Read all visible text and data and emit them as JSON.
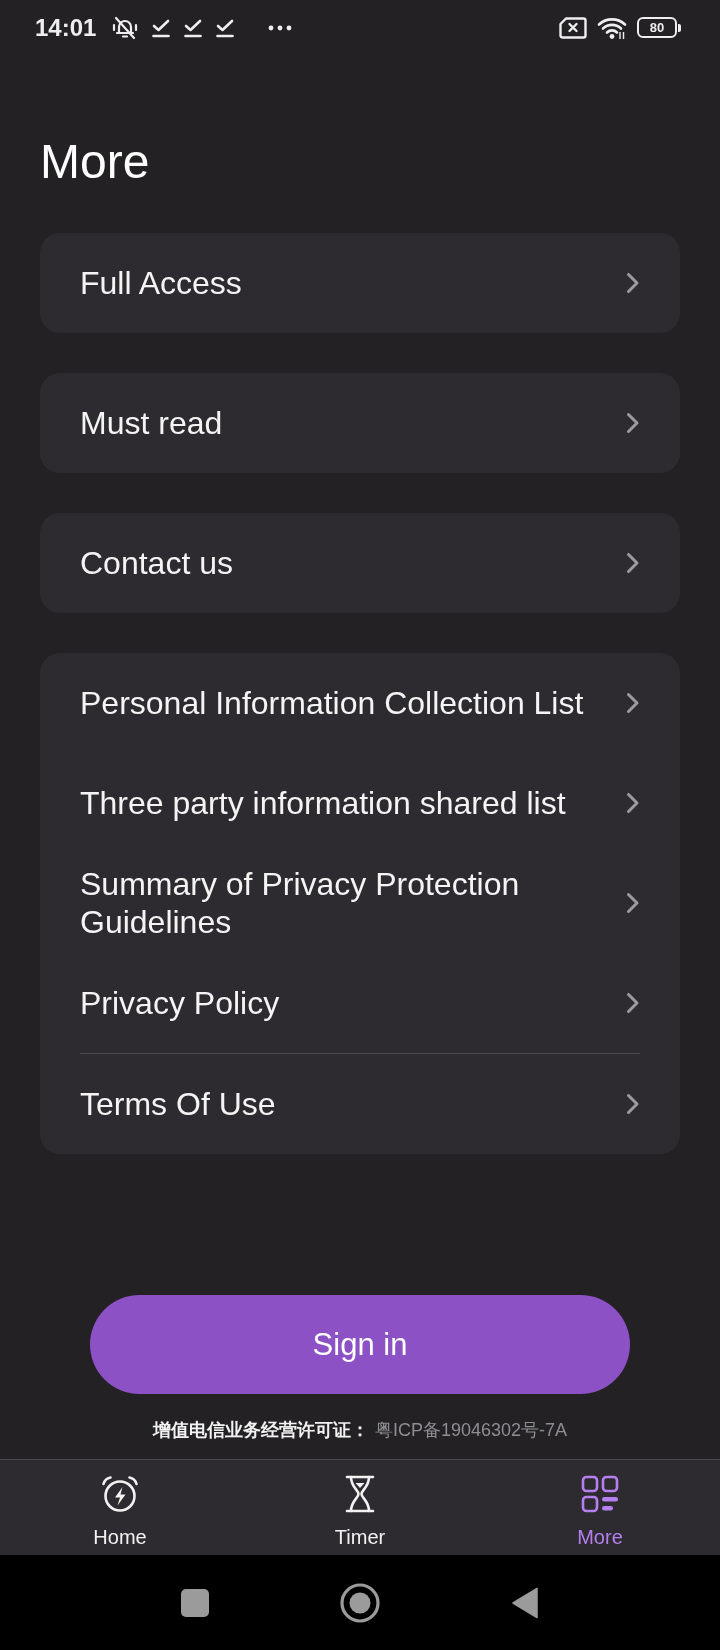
{
  "status_bar": {
    "time": "14:01",
    "battery": "80"
  },
  "title": "More",
  "sections": [
    {
      "items": [
        {
          "label": "Full Access"
        }
      ]
    },
    {
      "items": [
        {
          "label": "Must read"
        }
      ]
    },
    {
      "items": [
        {
          "label": "Contact us"
        }
      ]
    },
    {
      "items": [
        {
          "label": "Personal Information Collection List",
          "divider_above": false
        },
        {
          "label": "Three party information shared list",
          "divider_above": false
        },
        {
          "label": "Summary of Privacy Protection Guidelines",
          "divider_above": false
        },
        {
          "label": "Privacy Policy",
          "divider_above": false
        },
        {
          "label": "Terms Of Use",
          "divider_above": true
        }
      ]
    }
  ],
  "sign_in_button": {
    "label": "Sign in"
  },
  "license": {
    "label": "增值电信业务经营许可证：",
    "value": "粤ICP备19046302号-7A"
  },
  "tab_bar": {
    "items": [
      {
        "label": "Home",
        "selected": false
      },
      {
        "label": "Timer",
        "selected": false
      },
      {
        "label": "More",
        "selected": true
      }
    ]
  }
}
